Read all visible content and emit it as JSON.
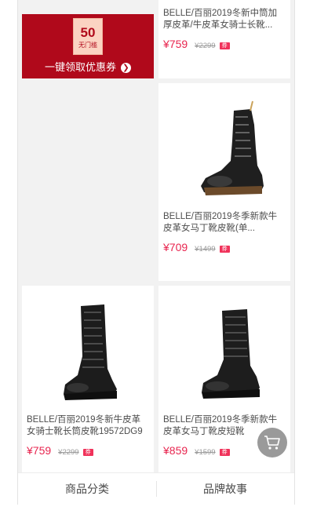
{
  "coupon": {
    "amount": "50",
    "threshold": "无门槛",
    "cta": "一键领取优惠券",
    "arrow": "❯"
  },
  "products": [
    {
      "title": "BELLE/百丽2019冬新中筒加厚皮革/牛皮革女骑士长靴...",
      "price": "¥759",
      "original_price": "¥2299",
      "tag": "券"
    },
    {
      "title": "BELLE/百丽2019冬季新款牛皮革女马丁靴皮靴(单...",
      "price": "¥709",
      "original_price": "¥1499",
      "tag": "券"
    },
    {
      "title": "BELLE/百丽2019冬新牛皮革女骑士靴长筒皮靴19572DG9",
      "price": "¥759",
      "original_price": "¥2299",
      "tag": "券"
    },
    {
      "title": "BELLE/百丽2019冬季新款牛皮革女马丁靴皮短靴93181DZ9",
      "price": "¥859",
      "original_price": "¥1599",
      "tag": "券"
    }
  ],
  "tabbar": {
    "categories": "商品分类",
    "brand_story": "品牌故事"
  },
  "icons": {
    "cart": "cart-icon"
  }
}
